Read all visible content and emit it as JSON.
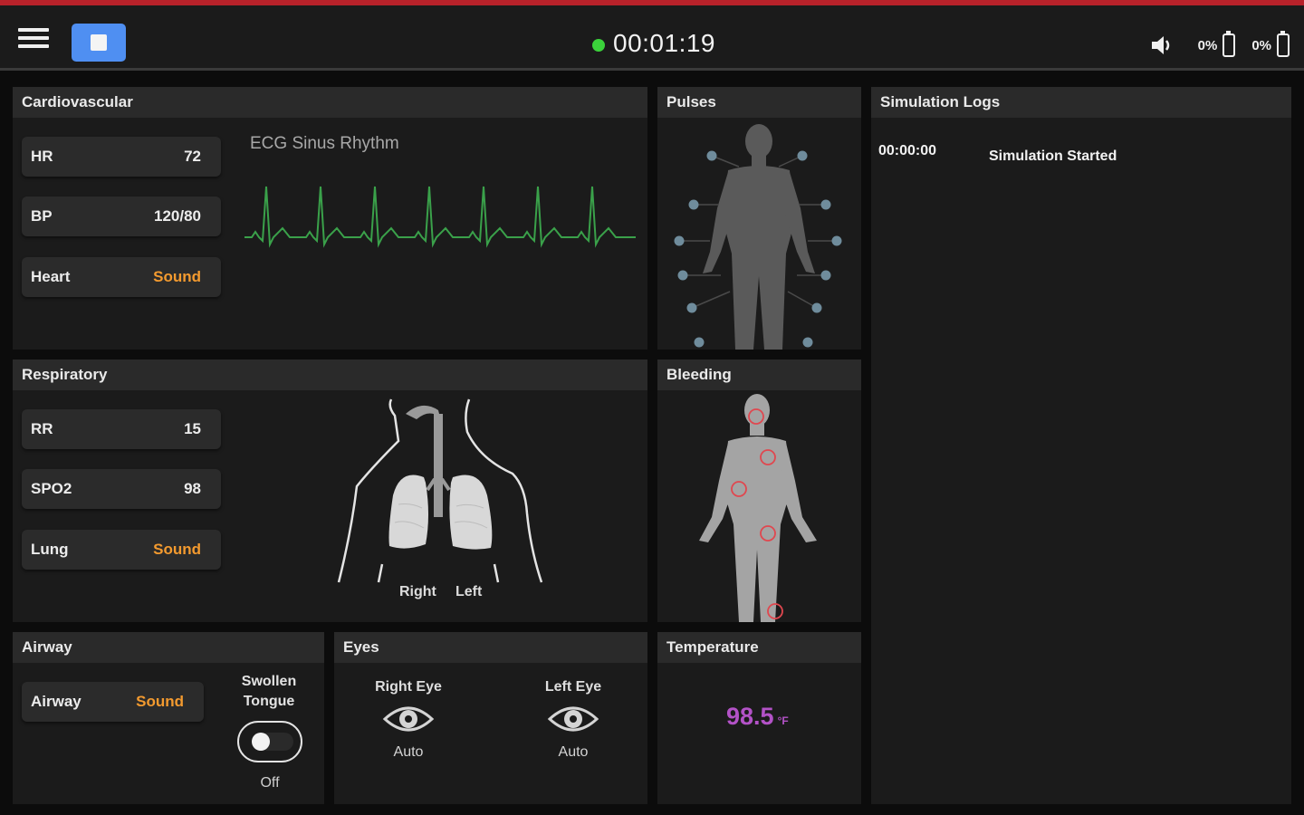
{
  "topbar": {
    "timer": "00:01:19",
    "status_color": "#3bd23b",
    "battery1_pct": "0%",
    "battery2_pct": "0%",
    "stop_button_color": "#4f8ff2"
  },
  "cardiovascular": {
    "title": "Cardiovascular",
    "hr_label": "HR",
    "hr_value": "72",
    "bp_label": "BP",
    "bp_value": "120/80",
    "heart_label": "Heart",
    "heart_value": "Sound",
    "ecg_label": "ECG Sinus Rhythm",
    "ecg_color": "#3aa14a"
  },
  "pulses": {
    "title": "Pulses"
  },
  "logs": {
    "title": "Simulation Logs",
    "entries": [
      {
        "time": "00:00:00",
        "message": "Simulation Started"
      }
    ]
  },
  "respiratory": {
    "title": "Respiratory",
    "rr_label": "RR",
    "rr_value": "15",
    "spo2_label": "SPO2",
    "spo2_value": "98",
    "lung_label": "Lung",
    "lung_value": "Sound",
    "right_label": "Right",
    "left_label": "Left"
  },
  "bleeding": {
    "title": "Bleeding",
    "marker_color": "#e0474f"
  },
  "airway": {
    "title": "Airway",
    "airway_label": "Airway",
    "airway_value": "Sound",
    "swollen_line1": "Swollen",
    "swollen_line2": "Tongue",
    "toggle_state": "Off"
  },
  "eyes": {
    "title": "Eyes",
    "right_eye": "Right Eye",
    "right_mode": "Auto",
    "left_eye": "Left Eye",
    "left_mode": "Auto"
  },
  "temperature": {
    "title": "Temperature",
    "value": "98.5",
    "unit": "°F",
    "color": "#b352c7"
  }
}
